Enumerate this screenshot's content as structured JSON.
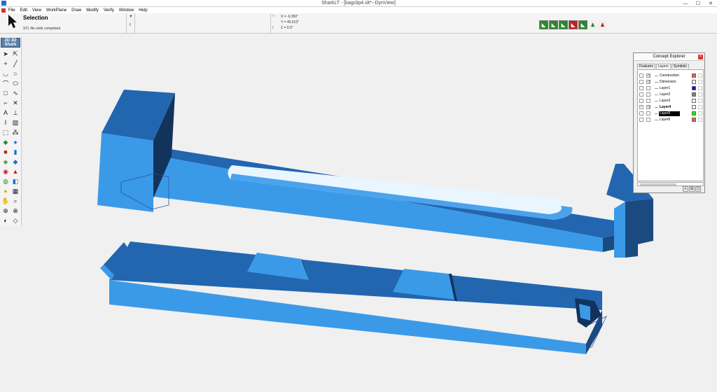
{
  "window": {
    "title": "SharkLT - [bagclip4.slt*--DynView]"
  },
  "menu": [
    "File",
    "Edit",
    "View",
    "WorkPlane",
    "Draw",
    "Modify",
    "Verify",
    "Window",
    "Help"
  ],
  "selection": {
    "title": "Selection",
    "message": "STL file write completed"
  },
  "coords": {
    "x": "X = -6.350\"",
    "y": "Y = 45.613\"",
    "z": "Z = 0.0\""
  },
  "sharkbox": {
    "top": "2D  3D",
    "brand": "Shark"
  },
  "explorer": {
    "title": "Concept Explorer",
    "tabs": [
      "Features",
      "Layers",
      "Symbols"
    ],
    "active_tab": "Layers",
    "layers": [
      {
        "name": "Construction",
        "color": "#e06060",
        "visible": "",
        "lock": "◁"
      },
      {
        "name": "Dimension",
        "color": "#ffffff",
        "visible": "",
        "lock": "◁"
      },
      {
        "name": "Layer1",
        "color": "#0000ff",
        "visible": "",
        "lock": ""
      },
      {
        "name": "Layer2",
        "color": "#808080",
        "visible": "",
        "lock": ""
      },
      {
        "name": "Layer3",
        "color": "#ffffff",
        "visible": "",
        "lock": ""
      },
      {
        "name": "Layer4",
        "color": "#ffffff",
        "visible": "✓",
        "lock": "◁"
      },
      {
        "name": "Layer5",
        "color": "#00ff00",
        "visible": "",
        "lock": ""
      },
      {
        "name": "Layer6",
        "color": "#e06060",
        "visible": "",
        "lock": ""
      }
    ],
    "active_layer": "Layer4",
    "selected_layer": "Layer5"
  },
  "colors": {
    "face_top": "#2266b0",
    "face_front": "#3a9ae8",
    "face_side": "#1a4a80",
    "face_dark": "#11335c"
  }
}
